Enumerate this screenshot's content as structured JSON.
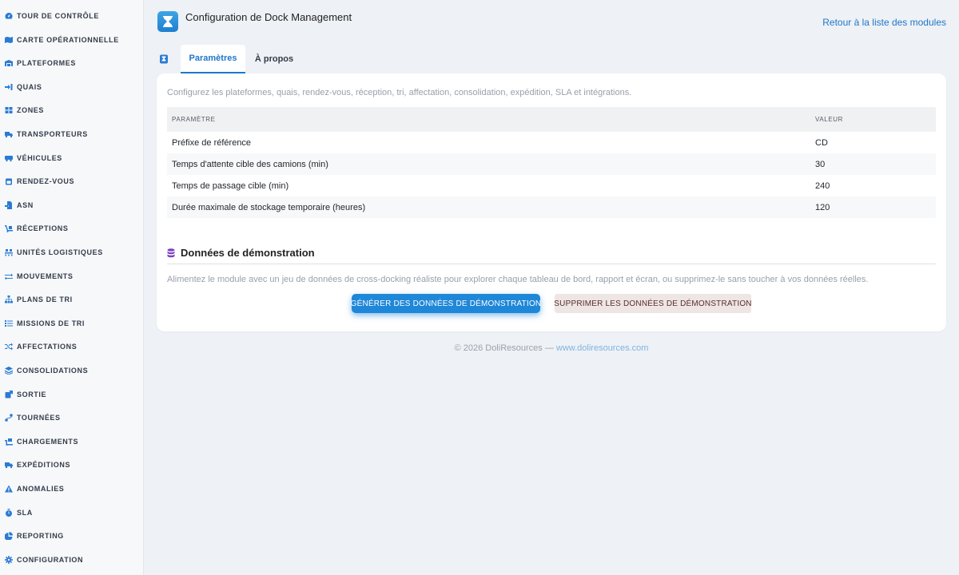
{
  "sidebar": {
    "items": [
      {
        "label": "TOUR DE CONTRÔLE",
        "icon": "gauge-icon"
      },
      {
        "label": "CARTE OPÉRATIONNELLE",
        "icon": "map-icon"
      },
      {
        "label": "PLATEFORMES",
        "icon": "warehouse-icon"
      },
      {
        "label": "QUAIS",
        "icon": "sign-in-icon"
      },
      {
        "label": "ZONES",
        "icon": "grid-icon"
      },
      {
        "label": "TRANSPORTEURS",
        "icon": "truck-icon"
      },
      {
        "label": "VÉHICULES",
        "icon": "bus-icon"
      },
      {
        "label": "RENDEZ-VOUS",
        "icon": "calendar-icon"
      },
      {
        "label": "ASN",
        "icon": "file-import-icon"
      },
      {
        "label": "RÉCEPTIONS",
        "icon": "dolly-icon"
      },
      {
        "label": "UNITÉS LOGISTIQUES",
        "icon": "pallet-icon"
      },
      {
        "label": "MOUVEMENTS",
        "icon": "exchange-icon"
      },
      {
        "label": "PLANS DE TRI",
        "icon": "sitemap-icon"
      },
      {
        "label": "MISSIONS DE TRI",
        "icon": "list-icon"
      },
      {
        "label": "AFFECTATIONS",
        "icon": "shuffle-icon"
      },
      {
        "label": "CONSOLIDATIONS",
        "icon": "layers-icon"
      },
      {
        "label": "SORTIE",
        "icon": "export-icon"
      },
      {
        "label": "TOURNÉES",
        "icon": "route-icon"
      },
      {
        "label": "CHARGEMENTS",
        "icon": "truck-loading-icon"
      },
      {
        "label": "EXPÉDITIONS",
        "icon": "shipping-icon"
      },
      {
        "label": "ANOMALIES",
        "icon": "warning-icon"
      },
      {
        "label": "SLA",
        "icon": "stopwatch-icon"
      },
      {
        "label": "REPORTING",
        "icon": "pie-chart-icon"
      },
      {
        "label": "CONFIGURATION",
        "icon": "gear-icon"
      }
    ]
  },
  "header": {
    "title": "Configuration de Dock Management",
    "back_link": "Retour à la liste des modules",
    "logo_icon": "dock-hourglass-icon"
  },
  "tabs": [
    {
      "label": "Paramètres",
      "active": true
    },
    {
      "label": "À propos",
      "active": false
    }
  ],
  "settings": {
    "intro": "Configurez les plateformes, quais, rendez-vous, réception, tri, affectation, consolidation, expédition, SLA et intégrations.",
    "columns": [
      "PARAMÈTRE",
      "VALEUR"
    ],
    "rows": [
      {
        "param": "Préfixe de référence",
        "value": "CD"
      },
      {
        "param": "Temps d'attente cible des camions (min)",
        "value": "30"
      },
      {
        "param": "Temps de passage cible (min)",
        "value": "240"
      },
      {
        "param": "Durée maximale de stockage temporaire (heures)",
        "value": "120"
      }
    ]
  },
  "demo": {
    "title": "Données de démonstration",
    "description": "Alimentez le module avec un jeu de données de cross-docking réaliste pour explorer chaque tableau de bord, rapport et écran, ou supprimez-le sans toucher à vos données réelles.",
    "generate_label": "GÉNÉRER DES DONNÉES DE DÉMONSTRATION",
    "delete_label": "SUPPRIMER LES DONNÉES DE DÉMONSTRATION"
  },
  "footer": {
    "copyright": "© 2026 DoliResources — ",
    "link": "www.doliresources.com"
  },
  "colors": {
    "accent": "#1f77c9",
    "sidebar_icon": "#2a7bd4",
    "demo_icon": "#7b3fc4",
    "delete_button_bg": "#ede6e4"
  }
}
